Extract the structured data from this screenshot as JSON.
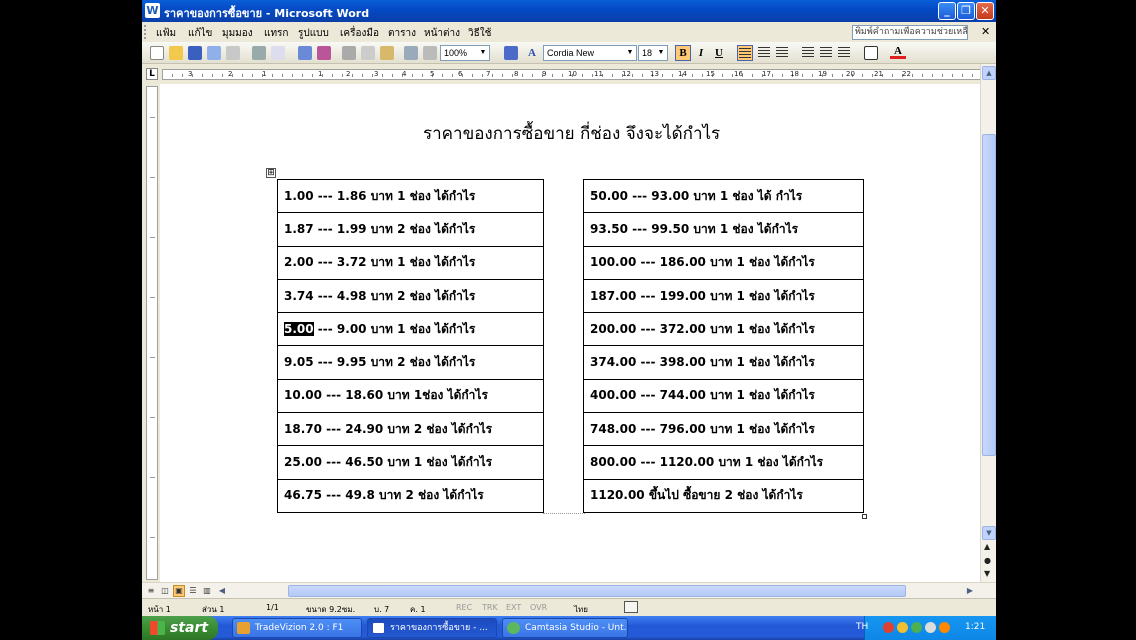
{
  "window": {
    "title": "ราคาของการซื้อขาย - Microsoft Word",
    "app_icon": "W",
    "minimize": "_",
    "maximize": "❐",
    "close": "✕"
  },
  "menu": {
    "items": [
      "แฟ้ม",
      "แก้ไข",
      "มุมมอง",
      "แทรก",
      "รูปแบบ",
      "เครื่องมือ",
      "ตาราง",
      "หน้าต่าง",
      "วิธีใช้"
    ],
    "help_placeholder": "พิมพ์คำถามเพื่อความช่วยเหลือ",
    "close": "✕"
  },
  "toolbar": {
    "zoom": "100%",
    "font": "Cordia New",
    "size": "18",
    "bold": "B",
    "italic": "I",
    "underline": "U",
    "font_color_label": "A",
    "style_label": "A"
  },
  "ruler": {
    "corner": "L",
    "labels": [
      "3",
      "2",
      "1",
      "1",
      "2",
      "3",
      "4",
      "5",
      "6",
      "7",
      "8",
      "9",
      "10",
      "11",
      "12",
      "13",
      "14",
      "15",
      "16",
      "17",
      "18",
      "19",
      "20",
      "21",
      "22"
    ]
  },
  "document": {
    "title": "ราคาของการซื้อขาย กี่ช่อง จึงจะได้กำไร",
    "table_handle": "⊞",
    "left_rows": [
      "1.00 ---    1.86    บาท 1 ช่อง  ได้กำไร",
      "1.87 ---    1.99    บาท 2 ช่อง  ได้กำไร",
      "2.00 ---    3.72    บาท 1 ช่อง  ได้กำไร",
      "3.74 ---    4.98    บาท 2 ช่อง  ได้กำไร",
      "---    9.00    บาท 1 ช่อง  ได้กำไร",
      "9.05 ---    9.95    บาท 2 ช่อง  ได้กำไร",
      "10.00 --- 18.60    บาท 1ช่อง  ได้กำไร",
      "18.70 --- 24.90    บาท 2 ช่อง  ได้กำไร",
      "25.00 --- 46.50    บาท 1 ช่อง  ได้กำไร",
      "46.75 --- 49.8      บาท 2 ช่อง  ได้กำไร"
    ],
    "selected_text": "5.00",
    "right_rows": [
      "50.00 ---    93.00    บาท 1 ช่อง  ได้ กำไร",
      "93.50 ---    99.50     บาท 1 ช่อง  ได้กำไร",
      "100.00 --- 186.00   บาท 1 ช่อง  ได้กำไร",
      "187.00 --- 199.00   บาท 1 ช่อง  ได้กำไร",
      "200.00 --- 372.00   บาท 1 ช่อง  ได้กำไร",
      "374.00 --- 398.00   บาท 1 ช่อง  ได้กำไร",
      "400.00 --- 744.00   บาท 1 ช่อง  ได้กำไร",
      "748.00 --- 796.00   บาท 1 ช่อง  ได้กำไร",
      "800.00 --- 1120.00 บาท 1 ช่อง  ได้กำไร",
      "1120.00  ขึ้นไป ซื้อขาย 2 ช่อง  ได้กำไร"
    ]
  },
  "statusbar": {
    "page": "หน้า 1",
    "section": "ส่วน 1",
    "pages": "1/1",
    "position": "ขนาด 9.2ซม.",
    "line": "บ. 7",
    "column": "ค. 1",
    "rec": "REC",
    "trk": "TRK",
    "ext": "EXT",
    "ovr": "OVR",
    "language": "ไทย"
  },
  "taskbar": {
    "start": "start",
    "tasks": [
      "TradeVizion 2.0 : F1",
      "ราคาของการซื้อขาย - ...",
      "Camtasia Studio - Unt..."
    ],
    "lang": "TH",
    "time": "1:21"
  }
}
